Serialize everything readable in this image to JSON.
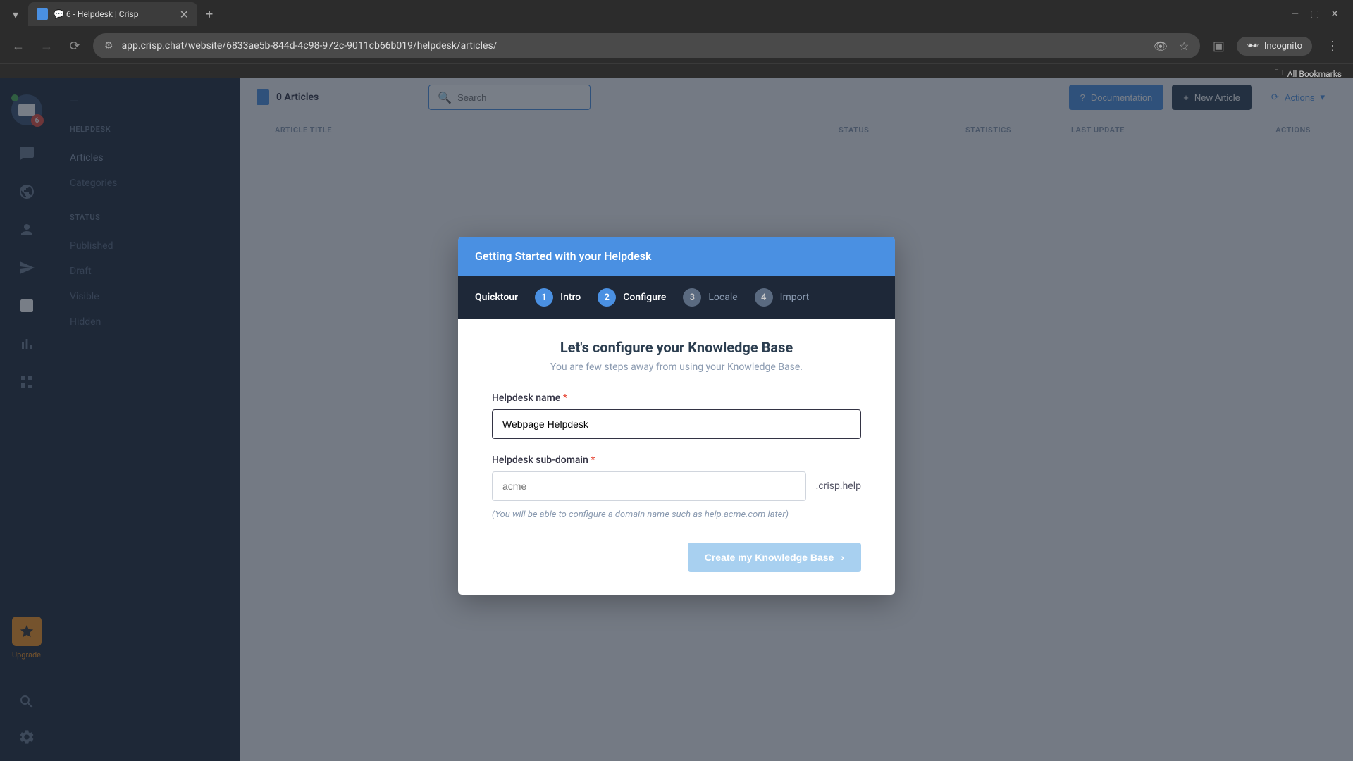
{
  "browser": {
    "tab_title": "💬 6 - Helpdesk | Crisp",
    "url": "app.crisp.chat/website/6833ae5b-844d-4c98-972c-9011cb66b019/helpdesk/articles/",
    "incognito_label": "Incognito",
    "bookmarks_label": "All Bookmarks"
  },
  "sidebar": {
    "badge_count": "6",
    "upgrade_label": "Upgrade",
    "section_helpdesk": "HELPDESK",
    "items_helpdesk": [
      "Articles",
      "Categories"
    ],
    "section_status": "STATUS",
    "items_status": [
      "Published",
      "Draft",
      "Visible",
      "Hidden"
    ]
  },
  "header": {
    "articles_count": "0 Articles",
    "search_placeholder": "Search",
    "btn_documentation": "Documentation",
    "btn_new_article": "New Article",
    "btn_actions": "Actions"
  },
  "table": {
    "th_title": "ARTICLE TITLE",
    "th_status": "STATUS",
    "th_stats": "STATISTICS",
    "th_update": "LAST UPDATE",
    "th_actions": "ACTIONS"
  },
  "modal": {
    "header": "Getting Started with your Helpdesk",
    "quicktour_label": "Quicktour",
    "steps": [
      {
        "num": "1",
        "name": "Intro",
        "state": "active"
      },
      {
        "num": "2",
        "name": "Configure",
        "state": "active"
      },
      {
        "num": "3",
        "name": "Locale",
        "state": "inactive"
      },
      {
        "num": "4",
        "name": "Import",
        "state": "inactive"
      }
    ],
    "title": "Let's configure your Knowledge Base",
    "subtitle": "You are few steps away from using your Knowledge Base.",
    "label_name": "Helpdesk name",
    "value_name": "Webpage Helpdesk",
    "label_subdomain": "Helpdesk sub-domain",
    "placeholder_subdomain": "acme",
    "suffix_subdomain": ".crisp.help",
    "hint": "(You will be able to configure a domain name such as help.acme.com later)",
    "btn_create": "Create my Knowledge Base"
  }
}
